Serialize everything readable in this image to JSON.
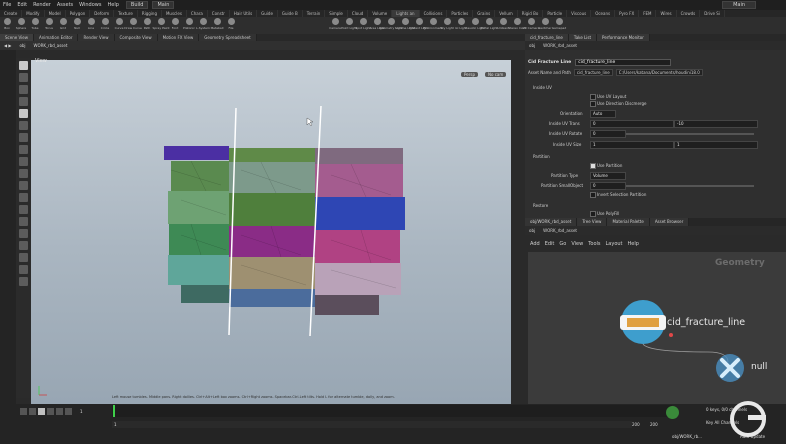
{
  "menubar": {
    "items": [
      "File",
      "Edit",
      "Render",
      "Assets",
      "Windows",
      "Help"
    ],
    "build_label": "Build",
    "desktop_label": "Main",
    "right_label": "Main"
  },
  "shelf_tabs": [
    "Create",
    "Modify",
    "Model",
    "Polygon",
    "Deform",
    "Texture",
    "Rigging",
    "Muscles",
    "Chara",
    "Constr",
    "Hair Utils",
    "Guide",
    "Guide B",
    "Terrain",
    "Simple",
    "Cloud",
    "Volume",
    "Lights an",
    "Collisions",
    "Particles",
    "Grains",
    "Vellum",
    "Rigid Bo",
    "Particle",
    "Viscous",
    "Oceans",
    "Pyro FX",
    "FEM",
    "Wires",
    "Crowds",
    "Drive Si"
  ],
  "shelf_tools": [
    "Box",
    "Sphere",
    "Tube",
    "Torus",
    "Grid",
    "Null",
    "Line",
    "Circle",
    "Curve",
    "Draw Curve",
    "Path",
    "Spray Paint",
    "Font",
    "Platonic",
    "L-System",
    "Metaball",
    "File"
  ],
  "shelf_tools_right": [
    "Camera",
    "Point Light",
    "Spot Light",
    "Area Light",
    "Geometry Light",
    "Volume Light",
    "Distant Light",
    "Environment",
    "Sky Light",
    "GI Light",
    "Caustic Light",
    "Portal Light",
    "Ambient",
    "Stereo Cam",
    "VR Camera",
    "Switcher",
    "Gamepad"
  ],
  "left_pane_tabs": [
    "Scene View",
    "Animation Editor",
    "Render View",
    "Composite View",
    "Motion FX View",
    "Geometry Spreadsheet"
  ],
  "left_path": [
    "obj",
    "WORK_rbd_asset"
  ],
  "viewport": {
    "title": "View",
    "camera": "Persp",
    "cam_menu": "No cam",
    "hint": "Left mouse tumbles. Middle pans. Right dollies. Ctrl+Alt+Left box zooms. Ctrl+Right zooms. Spacebar-Ctrl-Left tilts. Hold L for alternate tumble, dolly, and zoom."
  },
  "right_pane_tabs": [
    "cid_fracture_line",
    "Take List",
    "Performance Monitor"
  ],
  "right_path": [
    "obj",
    "WORK_rbd_asset"
  ],
  "params": {
    "node_type": "Cid Fracture Line",
    "node_name": "cid_fracture_line",
    "asset_label": "Asset Name and Path",
    "asset_name": "cid_fracture_line",
    "asset_path": "C:/Users/katana/Documents/houdini18.0",
    "section_inside_uv": "Inside UV",
    "use_uv_layout": "Use UV Layout",
    "use_direction_discrete": "Use Direction Discmerge",
    "orientation_label": "Orientation",
    "orientation_value": "Auto",
    "inside_uv_trans_label": "Inside UV Trans",
    "inside_uv_trans_x": "0",
    "inside_uv_trans_y": "-10",
    "inside_uv_rotate_label": "Inside UV Rotate",
    "inside_uv_rotate": "0",
    "inside_uv_size_label": "Inside UV Size",
    "inside_uv_size_x": "1",
    "inside_uv_size_y": "1",
    "section_partition": "Partition",
    "use_partition": "Use Partition",
    "partition_type_label": "Partition Type",
    "partition_type": "Volume",
    "partition_smallobject_label": "Partition SmallObject",
    "partition_smallobject": "0",
    "invert_selection": "Invert Selection Partition",
    "section_restore": "Restore",
    "use_polyfill": "Use PolyFill"
  },
  "network": {
    "tabs": [
      "obj/WORK_rbd_asset",
      "Tree View",
      "Material Palette",
      "Asset Browser"
    ],
    "path": [
      "obj",
      "WORK_rbd_asset"
    ],
    "menu": [
      "Add",
      "Edit",
      "Go",
      "View",
      "Tools",
      "Layout",
      "Help"
    ],
    "context_label": "Geometry",
    "node1": "cid_fracture_line",
    "node2": "null"
  },
  "timeline": {
    "current_frame": "1",
    "start_frame": "1",
    "end_frame": "200",
    "range_end": "200",
    "keys_label": "0 keys, 0/0 channels",
    "key_all": "Key All Channels",
    "auto_update": "Auto Update",
    "scene_path": "obj/WORK_rb..."
  }
}
